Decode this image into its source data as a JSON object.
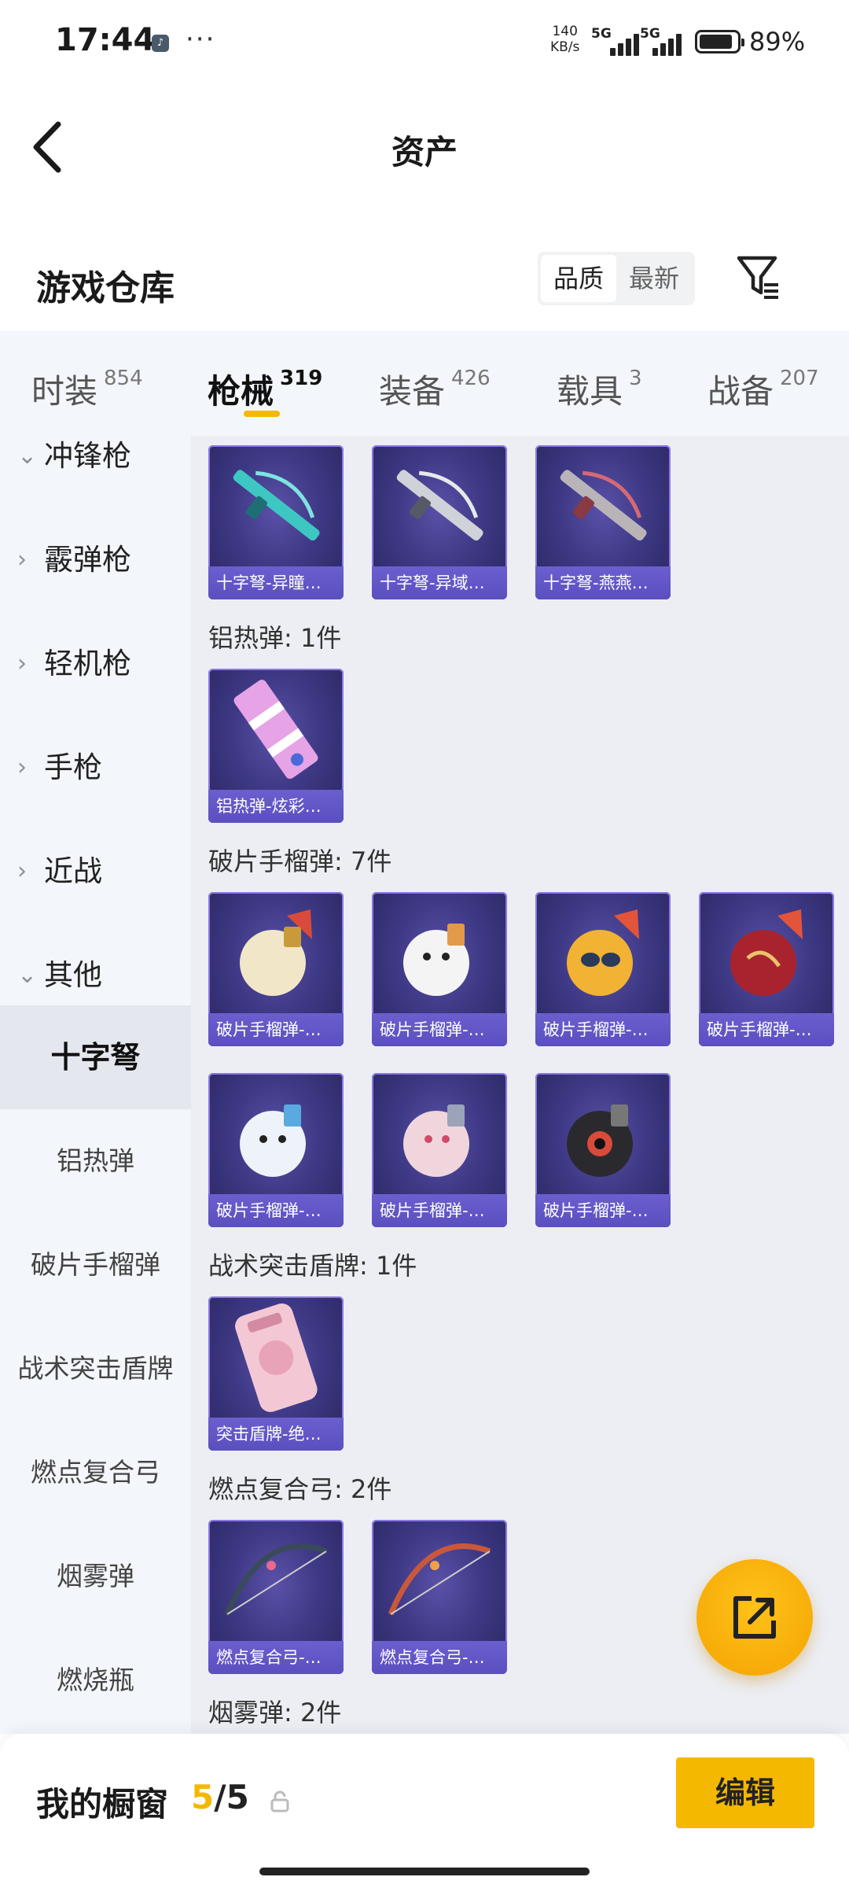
{
  "status_bar": {
    "time": "17:44",
    "app_icon": "tiktok-icon",
    "more": "···",
    "net_speed_top": "140",
    "net_speed_unit": "KB/s",
    "signal1_label": "5G",
    "signal2_label": "5G",
    "battery_percent": "89%",
    "battery_level": 0.89
  },
  "header": {
    "back_icon": "chevron-left-icon",
    "title": "资产"
  },
  "warehouse": {
    "title": "游戏仓库",
    "sort_options": [
      "品质",
      "最新"
    ],
    "sort_selected": "品质",
    "filter_icon": "filter-icon"
  },
  "tabs": [
    {
      "label": "时装",
      "count": "854"
    },
    {
      "label": "枪械",
      "count": "319",
      "active": true
    },
    {
      "label": "装备",
      "count": "426"
    },
    {
      "label": "载具",
      "count": "3"
    },
    {
      "label": "战备",
      "count": "207"
    }
  ],
  "sidebar": {
    "categories": [
      {
        "label": "冲锋枪",
        "icon": "chevron-down-icon"
      },
      {
        "label": "霰弹枪",
        "icon": "chevron-right-icon"
      },
      {
        "label": "轻机枪",
        "icon": "chevron-right-icon"
      },
      {
        "label": "手枪",
        "icon": "chevron-right-icon"
      },
      {
        "label": "近战",
        "icon": "chevron-right-icon"
      },
      {
        "label": "其他",
        "icon": "chevron-down-icon",
        "expanded": true
      }
    ],
    "subitems": [
      {
        "label": "十字弩",
        "active": true
      },
      {
        "label": "铝热弹"
      },
      {
        "label": "破片手榴弹"
      },
      {
        "label": "战术突击盾牌"
      },
      {
        "label": "燃点复合弓"
      },
      {
        "label": "烟雾弹"
      },
      {
        "label": "燃烧瓶"
      }
    ]
  },
  "content": {
    "crossbow_items": [
      "十字弩-异瞳…",
      "十字弩-异域…",
      "十字弩-燕燕…"
    ],
    "thermite_title": "铝热弹: 1件",
    "thermite_items": [
      "铝热弹-炫彩…"
    ],
    "grenade_title": "破片手榴弹: 7件",
    "grenade_items": [
      "破片手榴弹-…",
      "破片手榴弹-…",
      "破片手榴弹-…",
      "破片手榴弹-…",
      "破片手榴弹-…",
      "破片手榴弹-…",
      "破片手榴弹-…"
    ],
    "shield_title": "战术突击盾牌: 1件",
    "shield_items": [
      "突击盾牌-绝…"
    ],
    "bow_title": "燃点复合弓: 2件",
    "bow_items": [
      "燃点复合弓-…",
      "燃点复合弓-…"
    ],
    "smoke_title": "烟雾弹: 2件"
  },
  "fab": {
    "icon": "share-external-icon"
  },
  "bottom_bar": {
    "title": "我的橱窗",
    "count_current": "5",
    "count_sep": "/5",
    "lock_icon": "lock-icon",
    "edit_label": "编辑"
  },
  "colors": {
    "accent": "#f5b800",
    "card_bg": "#3e3985",
    "card_caption": "#5b4fc0",
    "sidebar_bg": "#f3f6fa",
    "content_bg": "#eceef3"
  }
}
